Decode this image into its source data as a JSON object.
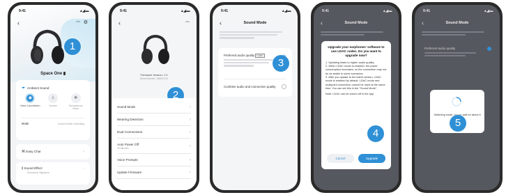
{
  "colors": {
    "accent": "#2f90d6",
    "badge": "#2f90d6",
    "dark_overlay": "#56585f"
  },
  "status": {
    "time": "9:41",
    "signal": "▲◢ ▬"
  },
  "screens": [
    {
      "step": "1",
      "device_name": "Space One",
      "ambient_title": "Ambient Sound",
      "modes": [
        {
          "label": "Noise Cancellation"
        },
        {
          "label": "Normal"
        },
        {
          "label": "Transparency Mode"
        }
      ],
      "mode_label": "Mode",
      "mode_value": "Custom Noise Cancelling",
      "easy_chat": "Easy Chat",
      "sound_effect": "Sound Effect",
      "sound_effect_sub": "Soundcore Signature"
    },
    {
      "step": "2",
      "firmware": "Firmware Version: 1.0",
      "serial": "Serial Number: 3460XXXX",
      "items": [
        {
          "label": "Sound Mode"
        },
        {
          "label": "Wearing Detection"
        },
        {
          "label": "Dual Connections"
        },
        {
          "label": "Auto Power Off",
          "sub": "30 Minutes"
        },
        {
          "label": "Voice Prompts"
        },
        {
          "label": "Update Firmware"
        }
      ]
    },
    {
      "step": "3",
      "title": "Sound Mode",
      "option1": "Preferred audio quality",
      "option1_badge": "LDAC",
      "option2": "Combine audio and connection quality"
    },
    {
      "step": "4",
      "title": "Sound Mode",
      "dialog_title": "Upgrade your earphones' software to use LDAC codec. Do you want to upgrade now?",
      "dialog_body": [
        "1. Updating leads to higher audio quality.",
        "2. When LDAC mode is enabled, the power consumption increases, so the connection may not be as stable in some scenarios.",
        "3. After you update to the latest version, LDAC mode is enabled by default. LDAC mode and multipoint connection cannot be used at the same time. You can set this in the \"Sound Mode\"."
      ],
      "dialog_note": "Note: LDAC can be turned off in the app",
      "cancel": "Cancel",
      "upgrade": "Upgrade"
    },
    {
      "step": "5",
      "title": "Sound Mode",
      "loading_text": "Switching mode, please wait for about 8 seconds."
    }
  ]
}
